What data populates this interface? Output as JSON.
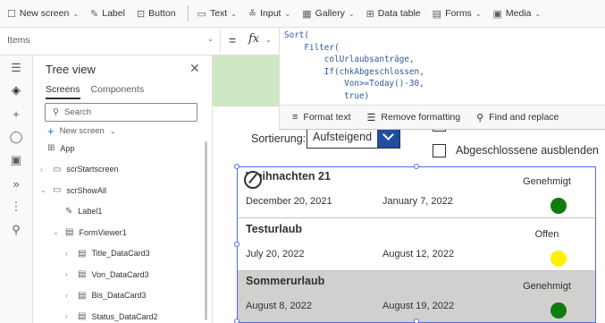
{
  "ribbon": {
    "items": [
      {
        "label": "New screen",
        "icon": "new-screen-icon",
        "glyph": "☐",
        "dropdown": true
      },
      {
        "label": "Label",
        "icon": "label-icon",
        "glyph": "✎",
        "dropdown": false
      },
      {
        "label": "Button",
        "icon": "button-icon",
        "glyph": "⊡",
        "dropdown": false
      },
      {
        "label": "Text",
        "icon": "text-input-icon",
        "glyph": "▭",
        "dropdown": true
      },
      {
        "label": "Input",
        "icon": "input-icon",
        "glyph": "≚",
        "dropdown": true
      },
      {
        "label": "Gallery",
        "icon": "gallery-icon",
        "glyph": "▦",
        "dropdown": true
      },
      {
        "label": "Data table",
        "icon": "data-table-icon",
        "glyph": "⊞",
        "dropdown": false
      },
      {
        "label": "Forms",
        "icon": "forms-icon",
        "glyph": "▤",
        "dropdown": true
      },
      {
        "label": "Media",
        "icon": "media-icon",
        "glyph": "▣",
        "dropdown": true
      }
    ]
  },
  "formula_bar": {
    "property": "Items",
    "equals": "=",
    "fx": "fx",
    "code_lines": [
      "Sort(",
      "    Filter(",
      "        colUrlaubsanträge,",
      "        If(chkAbgeschlossen,",
      "            Von>=Today()-30,",
      "            true)"
    ]
  },
  "formula_toolbar": {
    "format_text": "Format text",
    "remove_formatting": "Remove formatting",
    "find_replace": "Find and replace"
  },
  "tree_view": {
    "title": "Tree view",
    "tabs": [
      "Screens",
      "Components"
    ],
    "search_placeholder": "Search",
    "new_screen": "New screen",
    "nodes": [
      {
        "label": "App",
        "level": 0,
        "chevron": "",
        "icon": "app-icon"
      },
      {
        "label": "scrStartscreen",
        "level": 0,
        "chevron": ">",
        "icon": "screen-icon"
      },
      {
        "label": "scrShowAll",
        "level": 0,
        "chevron": "v",
        "icon": "screen-icon"
      },
      {
        "label": "Label1",
        "level": 1,
        "chevron": "",
        "icon": "label-icon"
      },
      {
        "label": "FormViewer1",
        "level": 1,
        "chevron": "v",
        "icon": "form-icon"
      },
      {
        "label": "Title_DataCard3",
        "level": 2,
        "chevron": ">",
        "icon": "card-icon"
      },
      {
        "label": "Von_DataCard3",
        "level": 2,
        "chevron": ">",
        "icon": "card-icon"
      },
      {
        "label": "Bis_DataCard3",
        "level": 2,
        "chevron": ">",
        "icon": "card-icon"
      },
      {
        "label": "Status_DataCard2",
        "level": 2,
        "chevron": ">",
        "icon": "card-icon"
      }
    ]
  },
  "canvas": {
    "sort_label": "Sortierung:",
    "sort_value": "Aufsteigend",
    "hide_completed_label": "Abgeschlossene ausblenden",
    "gallery": [
      {
        "title": "Weihnachten 21",
        "start": "December 20, 2021",
        "end": "January 7, 2022",
        "status": "Genehmigt",
        "status_color": "#107c10",
        "selected": false
      },
      {
        "title": "Testurlaub",
        "start": "July 20, 2022",
        "end": "August 12, 2022",
        "status": "Offen",
        "status_color": "#fff100",
        "selected": false
      },
      {
        "title": "Sommerurlaub",
        "start": "August 8, 2022",
        "end": "August 19, 2022",
        "status": "Genehmigt",
        "status_color": "#107c10",
        "selected": true
      }
    ]
  },
  "colors": {
    "header_band": "#cfe8c4",
    "dropdown_button": "#1f4ea3",
    "selection": "#4f6bed"
  }
}
